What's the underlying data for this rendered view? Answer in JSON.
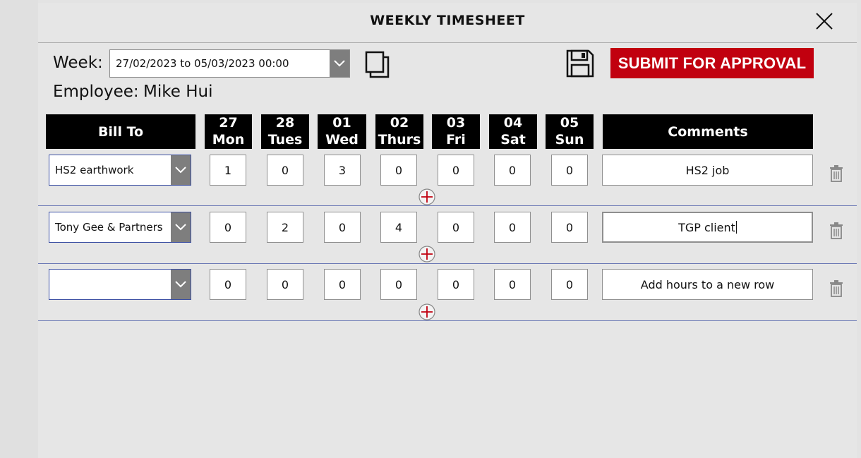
{
  "header": {
    "title": "WEEKLY TIMESHEET"
  },
  "week": {
    "label": "Week:",
    "value": "27/02/2023 to 05/03/2023 00:00"
  },
  "employee": {
    "label": "Employee:",
    "name": "Mike Hui"
  },
  "actions": {
    "submit_label": "SUBMIT FOR APPROVAL"
  },
  "columns": {
    "bill_to": "Bill To",
    "comments": "Comments",
    "days": [
      {
        "num": "27",
        "day": "Mon"
      },
      {
        "num": "28",
        "day": "Tues"
      },
      {
        "num": "01",
        "day": "Wed"
      },
      {
        "num": "02",
        "day": "Thurs"
      },
      {
        "num": "03",
        "day": "Fri"
      },
      {
        "num": "04",
        "day": "Sat"
      },
      {
        "num": "05",
        "day": "Sun"
      }
    ]
  },
  "rows": [
    {
      "bill_to": "HS2 earthwork",
      "hours": [
        "1",
        "0",
        "3",
        "0",
        "0",
        "0",
        "0"
      ],
      "comment": "HS2 job"
    },
    {
      "bill_to": "Tony Gee & Partners",
      "hours": [
        "0",
        "2",
        "0",
        "4",
        "0",
        "0",
        "0"
      ],
      "comment": "TGP client"
    },
    {
      "bill_to": "",
      "hours": [
        "0",
        "0",
        "0",
        "0",
        "0",
        "0",
        "0"
      ],
      "comment": "Add hours to a new row"
    }
  ],
  "colors": {
    "accent": "#c1000f",
    "header_bg": "#000000",
    "row_separator": "#6a78b5",
    "dropdown_chevron_bg": "#7e7e7e"
  }
}
